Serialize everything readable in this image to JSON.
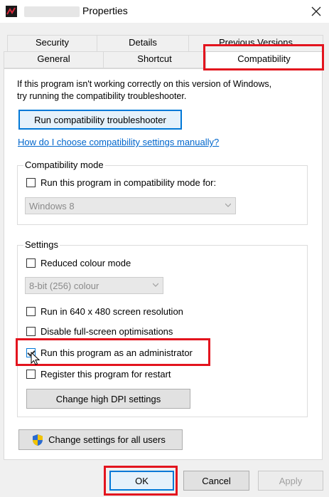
{
  "window": {
    "title": "Properties",
    "close_icon": "close-icon"
  },
  "tabs": {
    "row_back": [
      "Security",
      "Details",
      "Previous Versions"
    ],
    "row_front": [
      "General",
      "Shortcut",
      "Compatibility"
    ],
    "active": "Compatibility"
  },
  "intro": {
    "line1": "If this program isn't working correctly on this version of Windows,",
    "line2": "try running the compatibility troubleshooter."
  },
  "troubleshooter_button": "Run compatibility troubleshooter",
  "manual_link": "How do I choose compatibility settings manually?",
  "compat_mode": {
    "label": "Compatibility mode",
    "checkbox_label": "Run this program in compatibility mode for:",
    "checked": false,
    "dropdown_value": "Windows 8"
  },
  "settings": {
    "label": "Settings",
    "reduced_colour": {
      "label": "Reduced colour mode",
      "checked": false
    },
    "colour_dropdown_value": "8-bit (256) colour",
    "resolution": {
      "label": "Run in 640 x 480 screen resolution",
      "checked": false
    },
    "fullscreen": {
      "label": "Disable full-screen optimisations",
      "checked": false
    },
    "admin": {
      "label": "Run this program as an administrator",
      "checked": true
    },
    "restart": {
      "label": "Register this program for restart",
      "checked": false
    },
    "dpi_button": "Change high DPI settings"
  },
  "all_users_button": "Change settings for all users",
  "footer": {
    "ok": "OK",
    "cancel": "Cancel",
    "apply": "Apply"
  },
  "colors": {
    "highlight": "#e3141e",
    "link": "#0066cc",
    "focus": "#0078d7"
  }
}
